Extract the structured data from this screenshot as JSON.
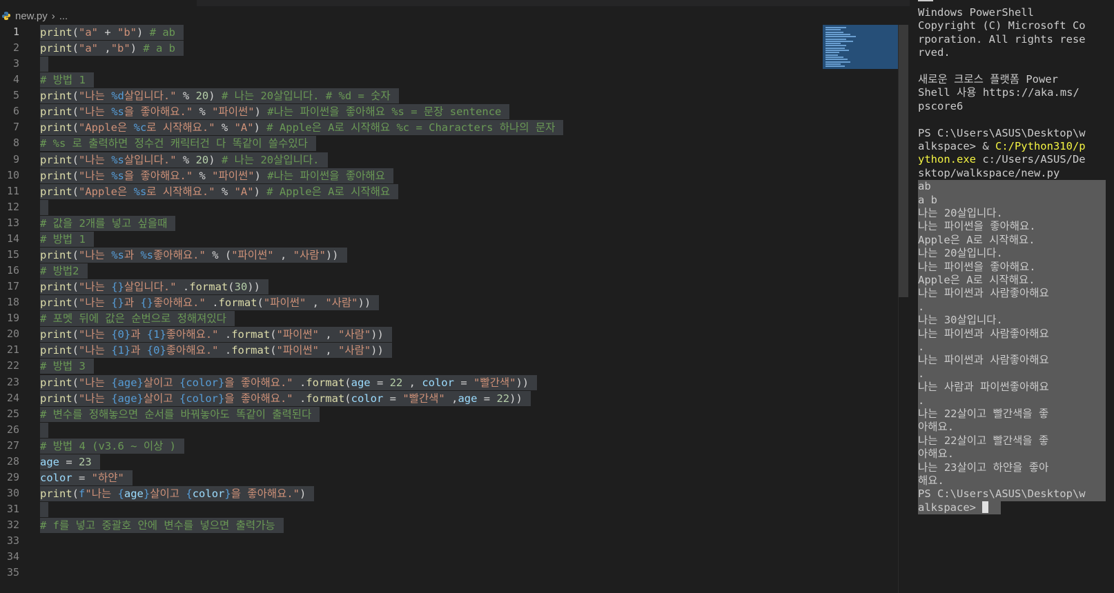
{
  "breadcrumb": {
    "file": "new.py",
    "more": "..."
  },
  "colors": {
    "background": "#1e1e1e",
    "selection": "#3a3d41",
    "comment": "#6a9955",
    "string": "#ce9178",
    "function": "#dcdcaa",
    "number": "#b5cea8",
    "format_specifier": "#569cd6",
    "variable": "#9cdcfe",
    "terminal_highlight": "#f5f543"
  },
  "editor": {
    "current_line": 1,
    "lines": [
      {
        "n": "1",
        "t": [
          [
            "fn",
            "print"
          ],
          [
            "pun",
            "("
          ],
          [
            "str",
            "\"a\""
          ],
          [
            "pun",
            " + "
          ],
          [
            "str",
            "\"b\""
          ],
          [
            "pun",
            ") "
          ],
          [
            "cmt",
            "# ab"
          ]
        ]
      },
      {
        "n": "2",
        "t": [
          [
            "fn",
            "print"
          ],
          [
            "pun",
            "("
          ],
          [
            "str",
            "\"a\""
          ],
          [
            "pun",
            " ,"
          ],
          [
            "str",
            "\"b\""
          ],
          [
            "pun",
            ") "
          ],
          [
            "cmt",
            "# a b"
          ]
        ]
      },
      {
        "n": "3",
        "t": []
      },
      {
        "n": "4",
        "t": [
          [
            "cmt",
            "# 방법 1"
          ]
        ]
      },
      {
        "n": "5",
        "t": [
          [
            "fn",
            "print"
          ],
          [
            "pun",
            "("
          ],
          [
            "str",
            "\"나는 "
          ],
          [
            "fmt",
            "%d"
          ],
          [
            "str",
            "살입니다.\""
          ],
          [
            "pun",
            " % "
          ],
          [
            "num",
            "20"
          ],
          [
            "pun",
            ") "
          ],
          [
            "cmt",
            "# 나는 20살입니다. # %d = 숫자"
          ]
        ]
      },
      {
        "n": "6",
        "t": [
          [
            "fn",
            "print"
          ],
          [
            "pun",
            "("
          ],
          [
            "str",
            "\"나는 "
          ],
          [
            "fmt",
            "%s"
          ],
          [
            "str",
            "을 좋아해요.\""
          ],
          [
            "pun",
            " % "
          ],
          [
            "str",
            "\"파이썬\""
          ],
          [
            "pun",
            ") "
          ],
          [
            "cmt",
            "#나는 파이썬을 좋아해요 %s = 문장 sentence"
          ]
        ]
      },
      {
        "n": "7",
        "t": [
          [
            "fn",
            "print"
          ],
          [
            "pun",
            "("
          ],
          [
            "str",
            "\"Apple은 "
          ],
          [
            "fmt",
            "%c"
          ],
          [
            "str",
            "로 시작해요.\""
          ],
          [
            "pun",
            " % "
          ],
          [
            "str",
            "\"A\""
          ],
          [
            "pun",
            ") "
          ],
          [
            "cmt",
            "# Apple은 A로 시작해요 %c = Characters 하나의 문자"
          ]
        ]
      },
      {
        "n": "8",
        "t": [
          [
            "cmt",
            "# %s 로 출력하면 정수건 캐릭터건 다 똑같이 쓸수있다"
          ]
        ]
      },
      {
        "n": "9",
        "t": [
          [
            "fn",
            "print"
          ],
          [
            "pun",
            "("
          ],
          [
            "str",
            "\"나는 "
          ],
          [
            "fmt",
            "%s"
          ],
          [
            "str",
            "살입니다.\""
          ],
          [
            "pun",
            " % "
          ],
          [
            "num",
            "20"
          ],
          [
            "pun",
            ") "
          ],
          [
            "cmt",
            "# 나는 20살입니다."
          ]
        ]
      },
      {
        "n": "10",
        "t": [
          [
            "fn",
            "print"
          ],
          [
            "pun",
            "("
          ],
          [
            "str",
            "\"나는 "
          ],
          [
            "fmt",
            "%s"
          ],
          [
            "str",
            "을 좋아해요.\""
          ],
          [
            "pun",
            " % "
          ],
          [
            "str",
            "\"파이썬\""
          ],
          [
            "pun",
            ") "
          ],
          [
            "cmt",
            "#나는 파이썬을 좋아해요"
          ]
        ]
      },
      {
        "n": "11",
        "t": [
          [
            "fn",
            "print"
          ],
          [
            "pun",
            "("
          ],
          [
            "str",
            "\"Apple은 "
          ],
          [
            "fmt",
            "%s"
          ],
          [
            "str",
            "로 시작해요.\""
          ],
          [
            "pun",
            " % "
          ],
          [
            "str",
            "\"A\""
          ],
          [
            "pun",
            ") "
          ],
          [
            "cmt",
            "# Apple은 A로 시작해요"
          ]
        ]
      },
      {
        "n": "12",
        "t": []
      },
      {
        "n": "13",
        "t": [
          [
            "cmt",
            "# 값을 2개를 넣고 싶을때"
          ]
        ]
      },
      {
        "n": "14",
        "t": [
          [
            "cmt",
            "# 방법 1"
          ]
        ]
      },
      {
        "n": "15",
        "t": [
          [
            "fn",
            "print"
          ],
          [
            "pun",
            "("
          ],
          [
            "str",
            "\"나는 "
          ],
          [
            "fmt",
            "%s"
          ],
          [
            "str",
            "과 "
          ],
          [
            "fmt",
            "%s"
          ],
          [
            "str",
            "좋아해요.\""
          ],
          [
            "pun",
            " % ("
          ],
          [
            "str",
            "\"파이썬\""
          ],
          [
            "pun",
            " , "
          ],
          [
            "str",
            "\"사람\""
          ],
          [
            "pun",
            "))"
          ]
        ]
      },
      {
        "n": "16",
        "t": [
          [
            "cmt",
            "# 방법2"
          ]
        ]
      },
      {
        "n": "17",
        "t": [
          [
            "fn",
            "print"
          ],
          [
            "pun",
            "("
          ],
          [
            "str",
            "\"나는 "
          ],
          [
            "fmt",
            "{}"
          ],
          [
            "str",
            "살입니다.\""
          ],
          [
            "pun",
            " ."
          ],
          [
            "fn",
            "format"
          ],
          [
            "pun",
            "("
          ],
          [
            "num",
            "30"
          ],
          [
            "pun",
            "))"
          ]
        ]
      },
      {
        "n": "18",
        "t": [
          [
            "fn",
            "print"
          ],
          [
            "pun",
            "("
          ],
          [
            "str",
            "\"나는 "
          ],
          [
            "fmt",
            "{}"
          ],
          [
            "str",
            "과 "
          ],
          [
            "fmt",
            "{}"
          ],
          [
            "str",
            "좋아해요.\""
          ],
          [
            "pun",
            " ."
          ],
          [
            "fn",
            "format"
          ],
          [
            "pun",
            "("
          ],
          [
            "str",
            "\"파이썬\""
          ],
          [
            "pun",
            " , "
          ],
          [
            "str",
            "\"사람\""
          ],
          [
            "pun",
            "))"
          ]
        ]
      },
      {
        "n": "19",
        "t": [
          [
            "cmt",
            "# 포멧 뒤에 값은 순번으로 정해져있다"
          ]
        ]
      },
      {
        "n": "20",
        "t": [
          [
            "fn",
            "print"
          ],
          [
            "pun",
            "("
          ],
          [
            "str",
            "\"나는 "
          ],
          [
            "fmt",
            "{0}"
          ],
          [
            "str",
            "과 "
          ],
          [
            "fmt",
            "{1}"
          ],
          [
            "str",
            "좋아해요.\""
          ],
          [
            "pun",
            " ."
          ],
          [
            "fn",
            "format"
          ],
          [
            "pun",
            "("
          ],
          [
            "str",
            "\"파이썬\""
          ],
          [
            "pun",
            " , "
          ],
          [
            "str",
            "\"사람\""
          ],
          [
            "pun",
            "))"
          ]
        ]
      },
      {
        "n": "21",
        "t": [
          [
            "fn",
            "print"
          ],
          [
            "pun",
            "("
          ],
          [
            "str",
            "\"나는 "
          ],
          [
            "fmt",
            "{1}"
          ],
          [
            "str",
            "과 "
          ],
          [
            "fmt",
            "{0}"
          ],
          [
            "str",
            "좋아해요.\""
          ],
          [
            "pun",
            " ."
          ],
          [
            "fn",
            "format"
          ],
          [
            "pun",
            "("
          ],
          [
            "str",
            "\"파이썬\""
          ],
          [
            "pun",
            " , "
          ],
          [
            "str",
            "\"사람\""
          ],
          [
            "pun",
            "))"
          ]
        ]
      },
      {
        "n": "22",
        "t": [
          [
            "cmt",
            "# 방법 3"
          ]
        ]
      },
      {
        "n": "23",
        "t": [
          [
            "fn",
            "print"
          ],
          [
            "pun",
            "("
          ],
          [
            "str",
            "\"나는 "
          ],
          [
            "fmt",
            "{age}"
          ],
          [
            "str",
            "살이고 "
          ],
          [
            "fmt",
            "{color}"
          ],
          [
            "str",
            "을 좋아해요.\""
          ],
          [
            "pun",
            " ."
          ],
          [
            "fn",
            "format"
          ],
          [
            "pun",
            "("
          ],
          [
            "var",
            "age"
          ],
          [
            "pun",
            " = "
          ],
          [
            "num",
            "22"
          ],
          [
            "pun",
            " , "
          ],
          [
            "var",
            "color"
          ],
          [
            "pun",
            " = "
          ],
          [
            "str",
            "\"빨간색\""
          ],
          [
            "pun",
            "))"
          ]
        ]
      },
      {
        "n": "24",
        "t": [
          [
            "fn",
            "print"
          ],
          [
            "pun",
            "("
          ],
          [
            "str",
            "\"나는 "
          ],
          [
            "fmt",
            "{age}"
          ],
          [
            "str",
            "살이고 "
          ],
          [
            "fmt",
            "{color}"
          ],
          [
            "str",
            "을 좋아해요.\""
          ],
          [
            "pun",
            " ."
          ],
          [
            "fn",
            "format"
          ],
          [
            "pun",
            "("
          ],
          [
            "var",
            "color"
          ],
          [
            "pun",
            " = "
          ],
          [
            "str",
            "\"빨간색\""
          ],
          [
            "pun",
            " ,"
          ],
          [
            "var",
            "age"
          ],
          [
            "pun",
            " = "
          ],
          [
            "num",
            "22"
          ],
          [
            "pun",
            "))"
          ]
        ]
      },
      {
        "n": "25",
        "t": [
          [
            "cmt",
            "# 변수를 정해놓으면 순서를 바꿔놓아도 똑같이 출력된다"
          ]
        ]
      },
      {
        "n": "26",
        "t": []
      },
      {
        "n": "27",
        "t": [
          [
            "cmt",
            "# 방법 4 (v3.6 ~ 이상 )"
          ]
        ]
      },
      {
        "n": "28",
        "t": [
          [
            "var",
            "age"
          ],
          [
            "pun",
            " = "
          ],
          [
            "num",
            "23"
          ]
        ]
      },
      {
        "n": "29",
        "t": [
          [
            "var",
            "color"
          ],
          [
            "pun",
            " = "
          ],
          [
            "str",
            "\"하얀\""
          ]
        ]
      },
      {
        "n": "30",
        "t": [
          [
            "fn",
            "print"
          ],
          [
            "pun",
            "("
          ],
          [
            "fmt",
            "f"
          ],
          [
            "str",
            "\"나는 "
          ],
          [
            "fmt",
            "{"
          ],
          [
            "var",
            "age"
          ],
          [
            "fmt",
            "}"
          ],
          [
            "str",
            "살이고 "
          ],
          [
            "fmt",
            "{"
          ],
          [
            "var",
            "color"
          ],
          [
            "fmt",
            "}"
          ],
          [
            "str",
            "을 좋아해요.\""
          ],
          [
            "pun",
            ")"
          ]
        ]
      },
      {
        "n": "31",
        "t": []
      },
      {
        "n": "32",
        "t": [
          [
            "cmt",
            "# f를 넣고 중괄호 안에 변수를 넣으면 출력가능"
          ]
        ]
      },
      {
        "n": "33",
        "t": null
      },
      {
        "n": "34",
        "t": null
      },
      {
        "n": "35",
        "t": null
      }
    ]
  },
  "terminal": {
    "lines": [
      {
        "text": "Windows PowerShell",
        "sel": false
      },
      {
        "text": "Copyright (C) Microsoft Co",
        "sel": false
      },
      {
        "text": "rporation. All rights rese",
        "sel": false
      },
      {
        "text": "rved.",
        "sel": false
      },
      {
        "text": "",
        "sel": false
      },
      {
        "text": "새로운 크로스 플랫폼 Power",
        "sel": false
      },
      {
        "text": "Shell 사용 https://aka.ms/",
        "sel": false
      },
      {
        "text": "pscore6",
        "sel": false
      },
      {
        "text": "",
        "sel": false
      },
      {
        "text": "PS C:\\Users\\ASUS\\Desktop\\w",
        "sel": false
      },
      {
        "parts": [
          [
            "n",
            "alkspace> & "
          ],
          [
            "y",
            "C:/Python310/p"
          ]
        ],
        "sel": false
      },
      {
        "parts": [
          [
            "y",
            "ython.exe"
          ],
          [
            "n",
            " c:/Users/ASUS/De"
          ]
        ],
        "sel": false
      },
      {
        "text": "sktop/walkspace/new.py",
        "sel": false
      },
      {
        "text": "ab",
        "sel": true
      },
      {
        "text": "a b",
        "sel": true
      },
      {
        "text": "나는 20살입니다.",
        "sel": true
      },
      {
        "text": "나는 파이썬을 좋아해요.",
        "sel": true
      },
      {
        "text": "Apple은 A로 시작해요.",
        "sel": true
      },
      {
        "text": "나는 20살입니다.",
        "sel": true
      },
      {
        "text": "나는 파이썬을 좋아해요.",
        "sel": true
      },
      {
        "text": "Apple은 A로 시작해요.",
        "sel": true
      },
      {
        "text": "나는 파이썬과 사람좋아해요",
        "sel": true
      },
      {
        "text": ".",
        "sel": true
      },
      {
        "text": "나는 30살입니다.",
        "sel": true
      },
      {
        "text": "나는 파이썬과 사람좋아해요",
        "sel": true
      },
      {
        "text": ".",
        "sel": true
      },
      {
        "text": "나는 파이썬과 사람좋아해요",
        "sel": true
      },
      {
        "text": ".",
        "sel": true
      },
      {
        "text": "나는 사람과 파이썬좋아해요",
        "sel": true
      },
      {
        "text": ".",
        "sel": true
      },
      {
        "text": "나는 22살이고 빨간색을 좋",
        "sel": true
      },
      {
        "text": "아해요.",
        "sel": true
      },
      {
        "text": "나는 22살이고 빨간색을 좋",
        "sel": true
      },
      {
        "text": "아해요.",
        "sel": true
      },
      {
        "text": "나는 23살이고 하얀을 좋아",
        "sel": true
      },
      {
        "text": "해요.",
        "sel": true
      },
      {
        "text": "PS C:\\Users\\ASUS\\Desktop\\w",
        "sel": true
      },
      {
        "text": "alkspace> ",
        "sel": true,
        "cursor": true
      }
    ]
  }
}
